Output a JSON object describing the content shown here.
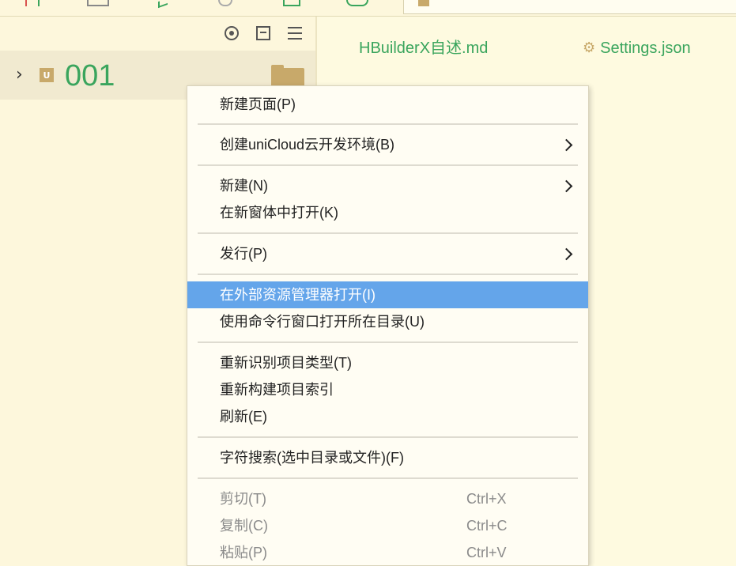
{
  "toolbar": {
    "path_text": ""
  },
  "project_panel": {
    "project_name": "001",
    "project_icon_letter": "U"
  },
  "tabs": [
    {
      "label": "HBuilderX自述.md"
    },
    {
      "label": "Settings.json"
    }
  ],
  "context_menu": {
    "items": [
      {
        "label": "新建页面(P)",
        "submenu": false
      },
      {
        "label": "创建uniCloud云开发环境(B)",
        "submenu": true
      },
      {
        "label": "新建(N)",
        "submenu": true
      },
      {
        "label": "在新窗体中打开(K)",
        "submenu": false
      },
      {
        "label": "发行(P)",
        "submenu": true
      },
      {
        "label": "在外部资源管理器打开(I)",
        "submenu": false,
        "highlighted": true
      },
      {
        "label": "使用命令行窗口打开所在目录(U)",
        "submenu": false
      },
      {
        "label": "重新识别项目类型(T)",
        "submenu": false
      },
      {
        "label": "重新构建项目索引",
        "submenu": false
      },
      {
        "label": "刷新(E)",
        "submenu": false
      },
      {
        "label": "字符搜索(选中目录或文件)(F)",
        "submenu": false
      },
      {
        "label": "剪切(T)",
        "shortcut": "Ctrl+X",
        "disabled": true
      },
      {
        "label": "复制(C)",
        "shortcut": "Ctrl+C",
        "disabled": true
      },
      {
        "label": "粘贴(P)",
        "shortcut": "Ctrl+V",
        "disabled": true
      }
    ]
  },
  "colors": {
    "background": "#fefae0",
    "accent_green": "#3aa55d",
    "highlight_blue": "#64a5ea",
    "folder_gold": "#c8a96a"
  }
}
